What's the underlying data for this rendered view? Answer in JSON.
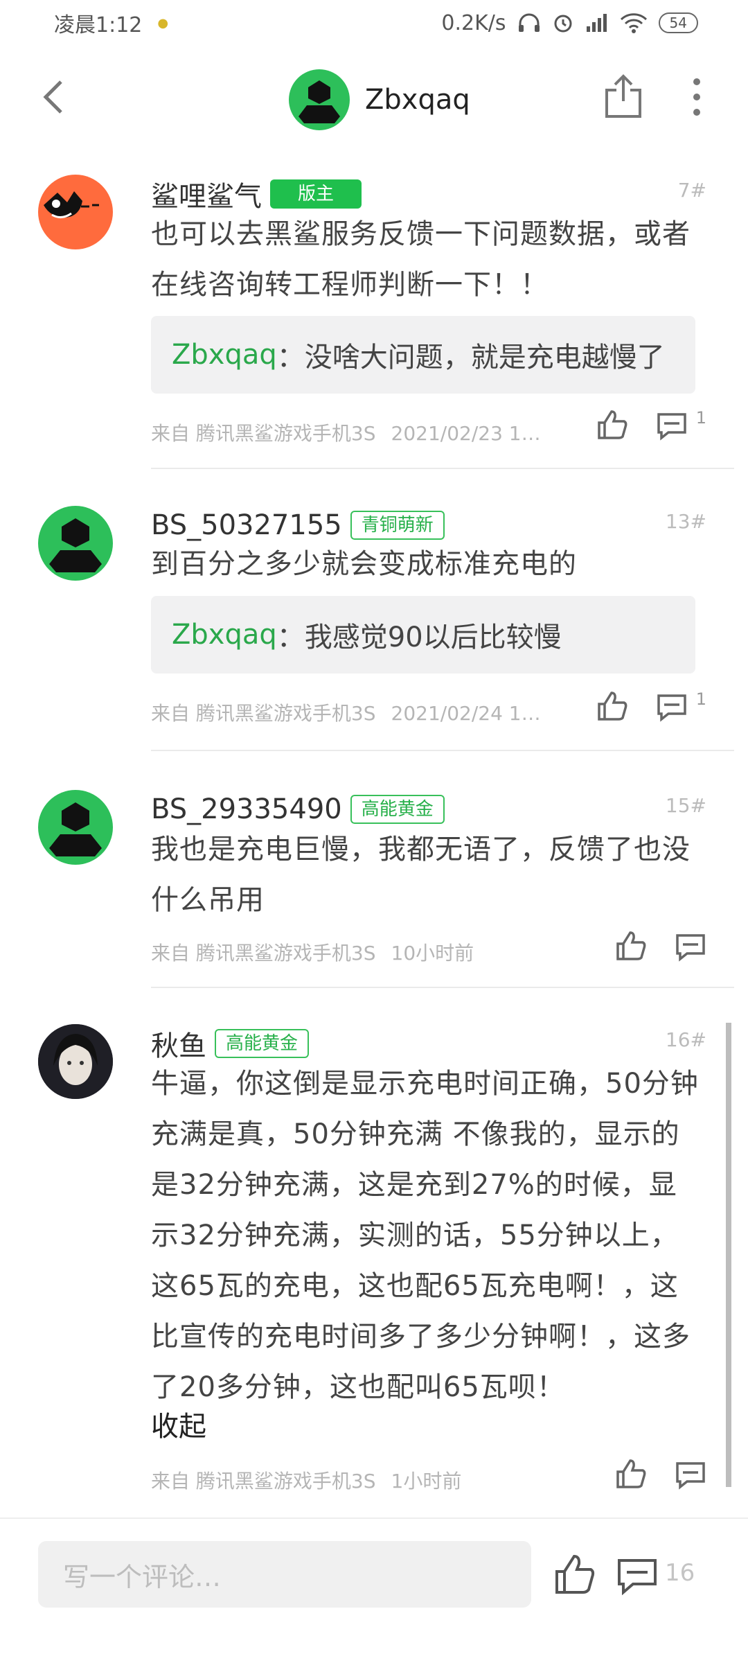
{
  "status_bar": {
    "time": "凌晨1:12",
    "speed": "0.2K/s",
    "battery": "54"
  },
  "app_bar": {
    "title": "Zbxqaq"
  },
  "posts": [
    {
      "username": "鲨哩鲨气",
      "badge": "版主",
      "floor": "7#",
      "content": "也可以去黑鲨服务反馈一下问题数据，或者在线咨询转工程师判断一下！！",
      "quote_user": "Zbxqaq",
      "quote_text": "：没啥大问题，就是充电越慢了",
      "source": "来自 腾讯黑鲨游戏手机3S",
      "time": "2021/02/23 1…",
      "comment_count": "1"
    },
    {
      "username": "BS_50327155",
      "badge": "青铜萌新",
      "floor": "13#",
      "content": "到百分之多少就会变成标准充电的",
      "quote_user": "Zbxqaq",
      "quote_text": "：我感觉90以后比较慢",
      "source": "来自 腾讯黑鲨游戏手机3S",
      "time": "2021/02/24 1…",
      "comment_count": "1"
    },
    {
      "username": "BS_29335490",
      "badge": "高能黄金",
      "floor": "15#",
      "content": "我也是充电巨慢，我都无语了，反馈了也没什么吊用",
      "source": "来自 腾讯黑鲨游戏手机3S",
      "time": "10小时前"
    },
    {
      "username": "秋鱼",
      "badge": "高能黄金",
      "floor": "16#",
      "content": "牛逼，你这倒是显示充电时间正确，50分钟充满是真，50分钟充满 不像我的，显示的是32分钟充满，这是充到27%的时候，显示32分钟充满，实测的话，55分钟以上，这65瓦的充电，这也配65瓦充电啊！，这比宣传的充电时间多了多少分钟啊！，这多了20多分钟，这也配叫65瓦呗！",
      "collapse": "收起",
      "source": "来自 腾讯黑鲨游戏手机3S",
      "time": "1小时前"
    }
  ],
  "bottom_bar": {
    "placeholder": "写一个评论…",
    "comment_count": "16"
  },
  "colors": {
    "accent_green": "#1fbf4d",
    "avatar_green": "#2dbf5a",
    "quote_name": "#2aa84b"
  }
}
